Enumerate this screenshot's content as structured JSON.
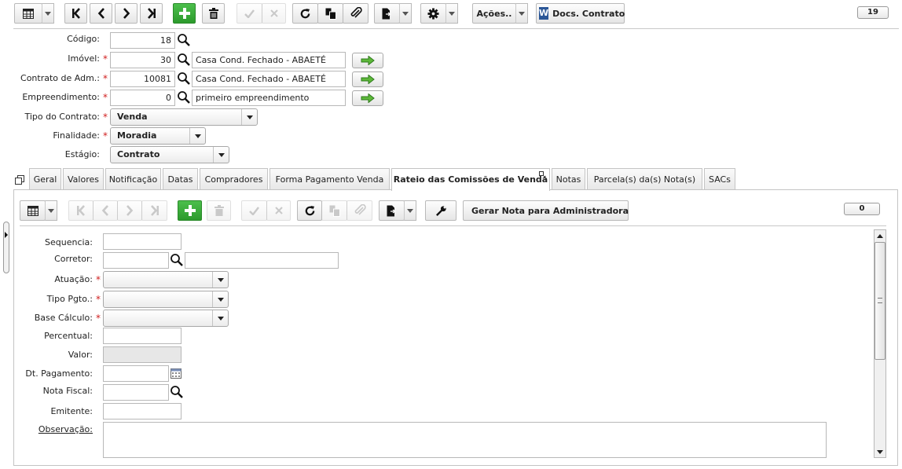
{
  "toolbar": {
    "acoes_label": "Ações..",
    "docs_label": "Docs. Contrato",
    "word_icon_letter": "W",
    "record_count": "19"
  },
  "form": {
    "codigo": {
      "label": "Código:",
      "value": "18"
    },
    "imovel": {
      "label": "Imóvel:",
      "value": "30",
      "desc": "Casa Cond. Fechado - ABAETÉ"
    },
    "contrato_adm": {
      "label": "Contrato de Adm.:",
      "value": "10081",
      "desc": "Casa Cond. Fechado - ABAETÉ"
    },
    "empreendimento": {
      "label": "Empreendimento:",
      "value": "0",
      "desc": "primeiro empreendimento"
    },
    "tipo_contrato": {
      "label": "Tipo do Contrato:",
      "value": "Venda"
    },
    "finalidade": {
      "label": "Finalidade:",
      "value": "Moradia"
    },
    "estagio": {
      "label": "Estágio:",
      "value": "Contrato"
    },
    "required_mark": "*"
  },
  "tabs": [
    {
      "label": "Geral"
    },
    {
      "label": "Valores"
    },
    {
      "label": "Notificação"
    },
    {
      "label": "Datas"
    },
    {
      "label": "Compradores"
    },
    {
      "label": "Forma Pagamento Venda"
    },
    {
      "label": "Rateio das Comissões de Venda"
    },
    {
      "label": "Notas"
    },
    {
      "label": "Parcela(s) da(s) Nota(s)"
    },
    {
      "label": "SACs"
    }
  ],
  "active_tab": "Rateio das Comissões de Venda",
  "subtoolbar": {
    "gerar_label": "Gerar Nota para Administradora",
    "record_count": "0"
  },
  "subform": {
    "sequencia": {
      "label": "Sequencia:",
      "value": ""
    },
    "corretor": {
      "label": "Corretor:",
      "value": "",
      "desc": ""
    },
    "atuacao": {
      "label": "Atuação:",
      "value": ""
    },
    "tipo_pgto": {
      "label": "Tipo Pgto.:",
      "value": ""
    },
    "base_calculo": {
      "label": "Base Cálculo:",
      "value": ""
    },
    "percentual": {
      "label": "Percentual:",
      "value": ""
    },
    "valor": {
      "label": "Valor:",
      "value": ""
    },
    "dt_pagamento": {
      "label": "Dt. Pagamento:",
      "value": ""
    },
    "nota_fiscal": {
      "label": "Nota Fiscal:",
      "value": ""
    },
    "emitente": {
      "label": "Emitente:",
      "value": ""
    },
    "observacao": {
      "label": "Observação:",
      "value": ""
    }
  },
  "colors": {
    "accent_green": "#2c9a2c",
    "required_red": "#d02020",
    "word_blue": "#2b5797"
  }
}
